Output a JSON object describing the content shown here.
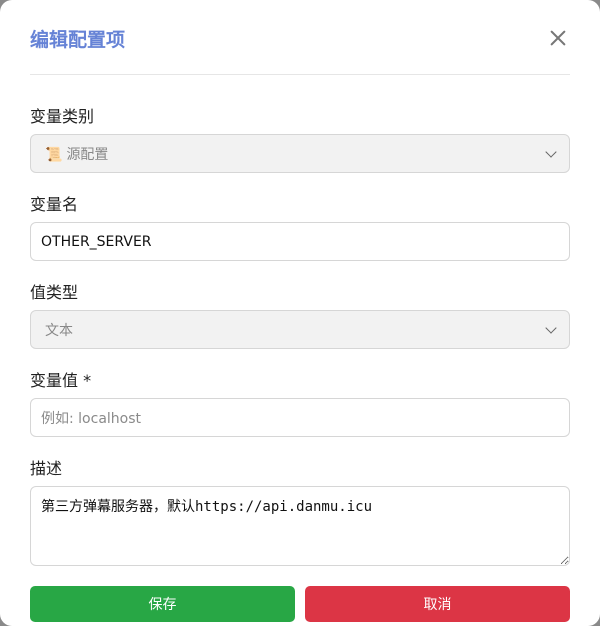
{
  "modal": {
    "title": "编辑配置项",
    "close_icon": "close-icon"
  },
  "fields": {
    "category": {
      "label": "变量类别",
      "value": "源配置",
      "icon": "📜"
    },
    "name": {
      "label": "变量名",
      "value": "OTHER_SERVER"
    },
    "value_type": {
      "label": "值类型",
      "value": "文本"
    },
    "value": {
      "label": "变量值 *",
      "placeholder": "例如: localhost"
    },
    "description": {
      "label": "描述",
      "value": "第三方弹幕服务器，默认https://api.danmu.icu"
    }
  },
  "buttons": {
    "save": "保存",
    "cancel": "取消"
  },
  "colors": {
    "title": "#6683d6",
    "save": "#28a745",
    "cancel": "#dc3545"
  }
}
